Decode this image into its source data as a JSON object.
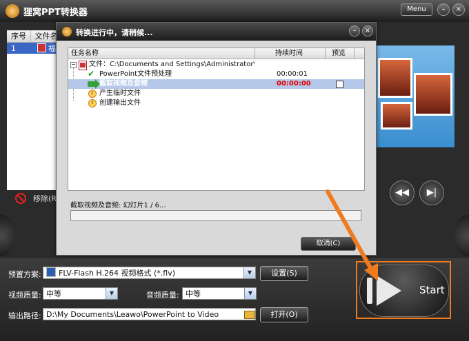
{
  "app": {
    "title": "狸窝PPT转换器",
    "menu_label": "Menu",
    "minimize": "–",
    "close": "×"
  },
  "file_list": {
    "headers": [
      "序号",
      "文件名"
    ],
    "rows": [
      {
        "index": "1",
        "name": "福"
      }
    ],
    "remove_label": "移除(R)"
  },
  "preview": {
    "rewind": "◀◀",
    "next": "▶|"
  },
  "settings": {
    "preset_label": "预置方案:",
    "preset_value": "FLV-Flash H.264 视频格式 (*.flv)",
    "settings_button": "设置(S)",
    "video_quality_label": "视频质量:",
    "video_quality_value": "中等",
    "audio_quality_label": "音频质量:",
    "audio_quality_value": "中等",
    "output_label": "输出路径:",
    "output_path": "D:\\My Documents\\Leawo\\PowerPoint to Video",
    "open_button": "打开(O)"
  },
  "start": {
    "label": "Start"
  },
  "dialog": {
    "title": "转换进行中，请稍候...",
    "columns": {
      "task": "任务名称",
      "duration": "持续时间",
      "preview": "预览"
    },
    "file_row": {
      "label": "文件：C:\\Documents and Settings\\Administrator\\桌面\\..."
    },
    "tasks": [
      {
        "name": "PowerPoint文件预处理",
        "duration": "00:00:01",
        "status": "done",
        "icon": "check-icon"
      },
      {
        "name": "截取视频及音频",
        "duration": "00:00:00",
        "status": "active",
        "icon": "arrow-icon"
      },
      {
        "name": "产生临时文件",
        "duration": "",
        "status": "pending",
        "icon": "clock-icon"
      },
      {
        "name": "创建输出文件",
        "duration": "",
        "status": "pending",
        "icon": "clock-icon"
      }
    ],
    "status_text": "截取视频及音频: 幻灯片1 / 6...",
    "progress": 0,
    "cancel_button": "取消(C)"
  },
  "colors": {
    "accent_orange": "#f07a1e",
    "active_text": "#e00000",
    "selection": "#b6c8ea"
  }
}
